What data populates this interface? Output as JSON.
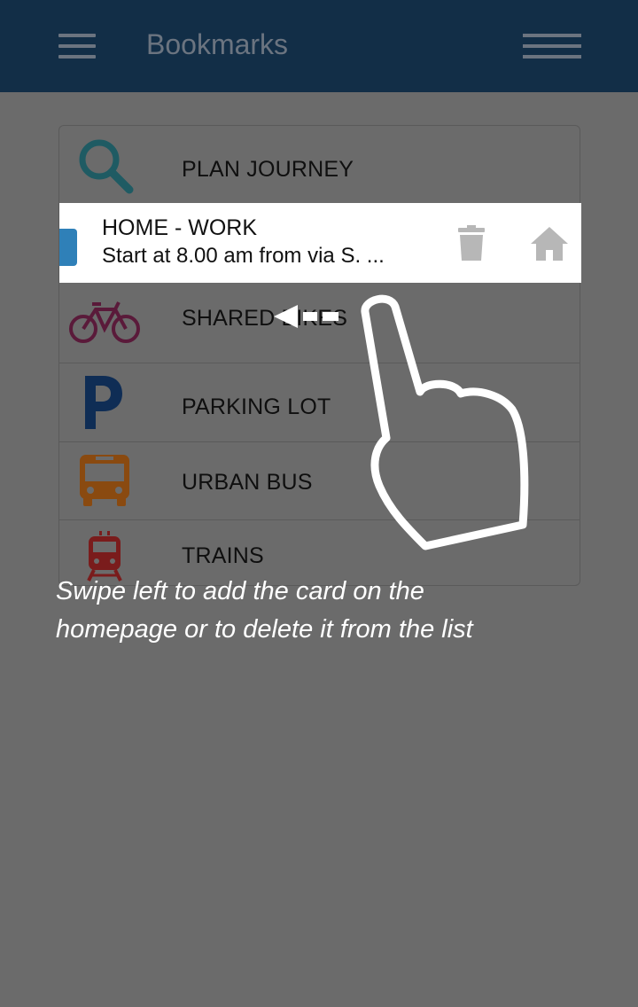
{
  "header": {
    "title": "Bookmarks"
  },
  "list": {
    "items": [
      {
        "label": "PLAN JOURNEY",
        "icon": "search-icon"
      },
      {
        "label": "SHARED BIKES",
        "icon": "bike-icon"
      },
      {
        "label": "PARKING LOT",
        "icon": "parking-icon"
      },
      {
        "label": "URBAN BUS",
        "icon": "bus-icon"
      },
      {
        "label": "TRAINS",
        "icon": "train-icon"
      }
    ],
    "bookmark": {
      "title": "HOME - WORK",
      "subtitle": "Start at 8.00 am from via S. ...",
      "actions": [
        "delete-icon",
        "home-icon"
      ]
    }
  },
  "hint": {
    "line1": "Swipe left to add the card on the",
    "line2": "homepage or to delete it from the list"
  },
  "colors": {
    "header_bg": "#122e47",
    "overlay_bg": "#6b6b6b",
    "bookmark_accent": "#2f80b8",
    "search_icon": "#1f5b63",
    "bike_icon": "#5a1a3a",
    "parking_icon": "#0f2d55",
    "bus_icon": "#8a4a10",
    "train_icon": "#7a1c1c"
  }
}
